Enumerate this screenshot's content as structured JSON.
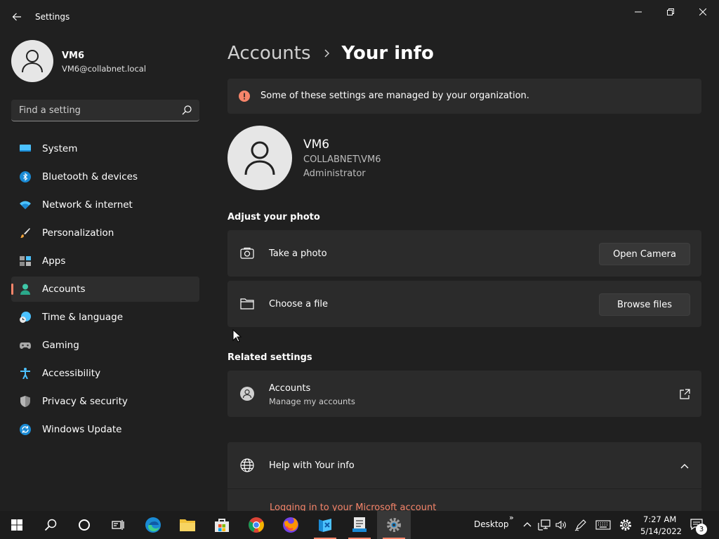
{
  "window": {
    "title": "Settings"
  },
  "user": {
    "name": "VM6",
    "email": "VM6@collabnet.local"
  },
  "search": {
    "placeholder": "Find a setting"
  },
  "sidebar": {
    "items": [
      {
        "label": "System",
        "icon": "monitor-icon"
      },
      {
        "label": "Bluetooth & devices",
        "icon": "bluetooth-icon"
      },
      {
        "label": "Network & internet",
        "icon": "wifi-icon"
      },
      {
        "label": "Personalization",
        "icon": "paintbrush-icon"
      },
      {
        "label": "Apps",
        "icon": "apps-icon"
      },
      {
        "label": "Accounts",
        "icon": "person-icon",
        "active": true
      },
      {
        "label": "Time & language",
        "icon": "clock-globe-icon"
      },
      {
        "label": "Gaming",
        "icon": "gamepad-icon"
      },
      {
        "label": "Accessibility",
        "icon": "accessibility-icon"
      },
      {
        "label": "Privacy & security",
        "icon": "shield-icon"
      },
      {
        "label": "Windows Update",
        "icon": "update-icon"
      }
    ]
  },
  "breadcrumb": {
    "parent": "Accounts",
    "current": "Your info"
  },
  "alert": {
    "text": "Some of these settings are managed by your organization."
  },
  "profile": {
    "name": "VM6",
    "domain": "COLLABNET\\VM6",
    "role": "Administrator"
  },
  "photo_section": {
    "title": "Adjust your photo",
    "take_photo": {
      "label": "Take a photo",
      "button": "Open Camera"
    },
    "choose_file": {
      "label": "Choose a file",
      "button": "Browse files"
    }
  },
  "related": {
    "title": "Related settings",
    "accounts": {
      "label": "Accounts",
      "sub": "Manage my accounts"
    }
  },
  "help": {
    "title": "Help with Your info",
    "link": "Logging in to your Microsoft account"
  },
  "taskbar": {
    "desktop_label": "Desktop",
    "overflow": "»",
    "time": "7:27 AM",
    "date": "5/14/2022",
    "notifications": "3"
  },
  "colors": {
    "accent": "#f7856a",
    "background": "#202020",
    "card": "#2b2b2b"
  }
}
